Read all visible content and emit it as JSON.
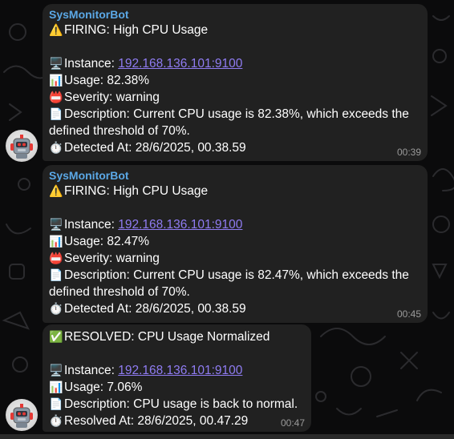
{
  "messages": [
    {
      "sender": "SysMonitorBot",
      "title": "FIRING: High CPU Usage",
      "instance_label": "Instance: ",
      "instance_value": "192.168.136.101:9100",
      "usage": "Usage: 82.38%",
      "severity": "Severity: warning",
      "description": "Description: Current CPU usage is 82.38%, which exceeds the defined threshold of 70%.",
      "detected": "Detected At: 28/6/2025, 00.38.59",
      "time": "00:39"
    },
    {
      "sender": "SysMonitorBot",
      "title": "FIRING: High CPU Usage",
      "instance_label": "Instance: ",
      "instance_value": "192.168.136.101:9100",
      "usage": "Usage: 82.47%",
      "severity": "Severity: warning",
      "description": "Description: Current CPU usage is 82.47%, which exceeds the defined threshold of 70%.",
      "detected": "Detected At: 28/6/2025, 00.38.59",
      "time": "00:45"
    },
    {
      "title": "RESOLVED: CPU Usage Normalized",
      "instance_label": "Instance: ",
      "instance_value": "192.168.136.101:9100",
      "usage": "Usage: 7.06%",
      "description": "Description: CPU usage is back to normal.",
      "resolved": "Resolved At: 28/6/2025, 00.47.29",
      "time": "00:47"
    }
  ],
  "icons": {
    "warning": "warning-icon",
    "monitor": "desktop-computer-icon",
    "chart": "bar-chart-icon",
    "severity": "siren-badge-icon",
    "description": "document-icon",
    "clock": "stopwatch-icon",
    "resolved": "check-mark-button-icon",
    "avatar": "robot-avatar-icon"
  },
  "colors": {
    "bubble": "#212121",
    "sender": "#5ba8e6",
    "link": "#8f7cf2",
    "timestamp": "#9a9a9a",
    "background": "#0b0b0c"
  }
}
